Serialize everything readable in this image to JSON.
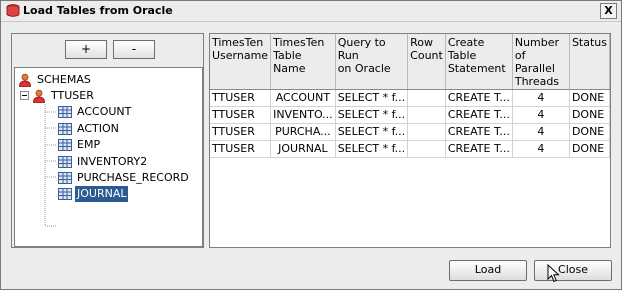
{
  "window": {
    "title": "Load Tables from Oracle",
    "close_glyph": "X"
  },
  "tree_panel": {
    "add_label": "+",
    "remove_label": "-",
    "root": "SCHEMAS",
    "schema": "TTUSER",
    "tables": [
      "ACCOUNT",
      "ACTION",
      "EMP",
      "INVENTORY2",
      "PURCHASE_RECORD",
      "JOURNAL"
    ],
    "selected_table": "JOURNAL"
  },
  "grid": {
    "columns": [
      [
        "TimesTen",
        "Username"
      ],
      [
        "TimesTen",
        "Table Name"
      ],
      [
        "Query to Run",
        "on Oracle"
      ],
      [
        "Row",
        "Count"
      ],
      [
        "Create Table",
        "Statement"
      ],
      [
        "Number of",
        "Parallel Threads"
      ],
      [
        "Status",
        ""
      ]
    ],
    "rows": [
      [
        "TTUSER",
        "ACCOUNT",
        "SELECT * f...",
        "",
        "CREATE T...",
        "4",
        "DONE"
      ],
      [
        "TTUSER",
        "INVENTO...",
        "SELECT * f...",
        "",
        "CREATE T...",
        "4",
        "DONE"
      ],
      [
        "TTUSER",
        "PURCHA...",
        "SELECT * f...",
        "",
        "CREATE T...",
        "4",
        "DONE"
      ],
      [
        "TTUSER",
        "JOURNAL",
        "SELECT * f...",
        "",
        "CREATE T...",
        "4",
        "DONE"
      ]
    ]
  },
  "buttons": {
    "load": "Load",
    "close": "Close"
  },
  "icons": {
    "window": "oracle-db-icon",
    "root": "user-icon",
    "schema": "user-icon",
    "table": "table-icon",
    "collapse": "tree-collapse-icon"
  }
}
